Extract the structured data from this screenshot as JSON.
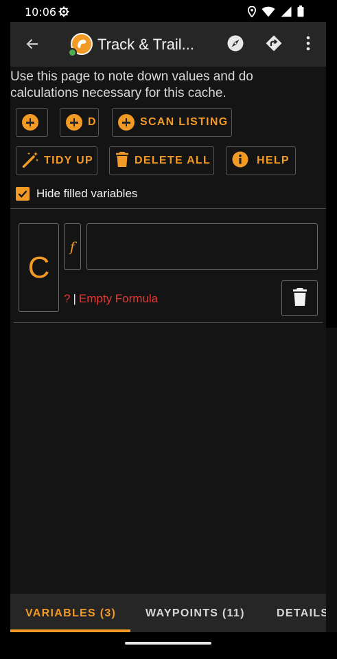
{
  "status_bar": {
    "time": "10:06",
    "icons": [
      "gear-icon",
      "location-icon",
      "wifi-icon",
      "signal-icon",
      "battery-icon"
    ]
  },
  "toolbar": {
    "title": "Track & Trail...",
    "icons": [
      "back-arrow-icon",
      "app-logo-icon",
      "compass-icon",
      "navigate-icon",
      "more-vert-icon"
    ]
  },
  "intro_text": "Use this page to note down values and do calculations necessary for this cache.",
  "buttons": {
    "add_label": "",
    "add_d_label": "D",
    "scan_listing_label": "SCAN LISTING",
    "tidy_up_label": "TIDY UP",
    "delete_all_label": "DELETE ALL",
    "help_label": "HELP"
  },
  "hide_filled": {
    "label": "Hide filled variables",
    "checked": true
  },
  "variable": {
    "name": "C",
    "formula_symbol": "f",
    "formula_value": "",
    "status_question": "?",
    "status_separator": "|",
    "status_error": "Empty Formula"
  },
  "tabs": [
    {
      "label": "VARIABLES (3)",
      "active": true
    },
    {
      "label": "WAYPOINTS (11)",
      "active": false
    },
    {
      "label": "DETAILS",
      "active": false
    }
  ],
  "colors": {
    "accent": "#f29a26",
    "error": "#e53935",
    "toolbar": "#262626",
    "background": "#141414"
  }
}
